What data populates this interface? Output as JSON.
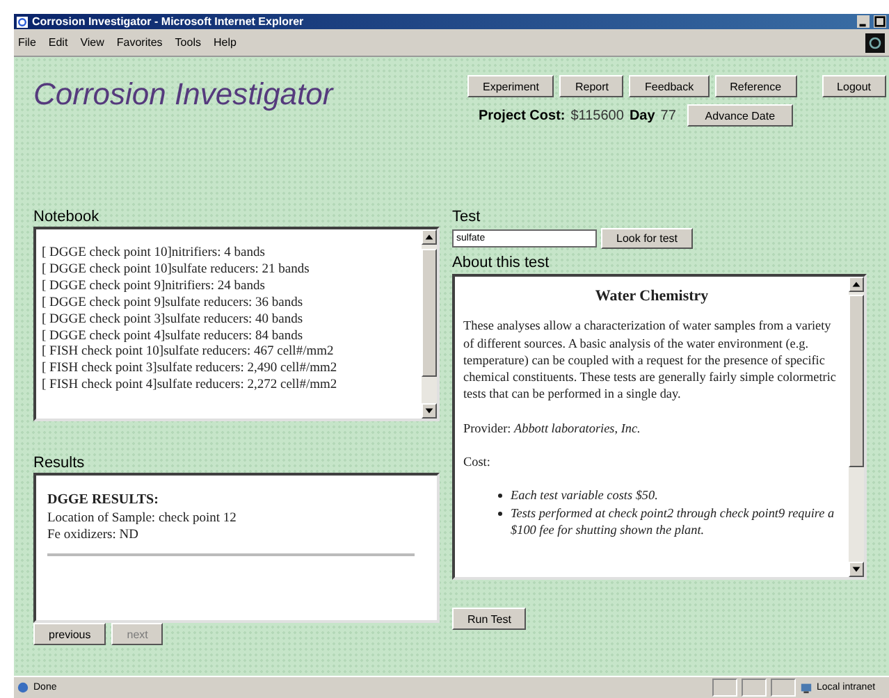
{
  "window": {
    "title": "Corrosion Investigator - Microsoft Internet Explorer"
  },
  "menu": [
    "File",
    "Edit",
    "View",
    "Favorites",
    "Tools",
    "Help"
  ],
  "header": {
    "title": "Corrosion Investigator",
    "nav_buttons": [
      "Experiment",
      "Report",
      "Feedback",
      "Reference"
    ],
    "logout": "Logout",
    "project_cost_label": "Project Cost:",
    "project_cost": "$115600",
    "day_label": "Day",
    "day": "77",
    "advance_button": "Advance Date"
  },
  "notebook": {
    "title": "Notebook",
    "entries": [
      "[ DGGE check point 10]nitrifiers: 4 bands",
      "[ DGGE check point 10]sulfate reducers: 21 bands",
      "[ DGGE check point 9]nitrifiers: 24 bands",
      "[ DGGE check point 9]sulfate reducers: 36 bands",
      "[ DGGE check point 3]sulfate reducers: 40 bands",
      "[ DGGE check point 4]sulfate reducers: 84 bands",
      "[ FISH check point 10]sulfate reducers: 467 cell#/mm2",
      "[ FISH check point 3]sulfate reducers: 2,490 cell#/mm2",
      "[ FISH check point 4]sulfate reducers: 2,272 cell#/mm2"
    ]
  },
  "results": {
    "title": "Results",
    "heading": "DGGE RESULTS:",
    "lines": [
      "Location of Sample: check point 12",
      "Fe oxidizers: ND"
    ]
  },
  "pager": [
    {
      "label": "previous",
      "disabled": false
    },
    {
      "label": "next",
      "disabled": true
    }
  ],
  "test": {
    "title": "Test",
    "value": "sulfate",
    "button": "Look for test"
  },
  "about": {
    "title": "About this test",
    "heading": "Water Chemistry",
    "paragraph": "These analyses allow a characterization of water samples from a variety of different sources. A basic analysis of the water environment (e.g. temperature) can be coupled with a request for the presence of specific chemical constituents. These tests are generally fairly simple colormetric tests that can be performed in a single day.",
    "provider": "Provider: *Abbott laboratories, Inc.*",
    "cost_label": "Cost:",
    "cost_items": [
      "Each test variable costs $50.",
      "Tests performed at check point2 through check point9 require a $100 fee for shutting shown the plant."
    ]
  },
  "run_button": "Run Test",
  "status_bar": {
    "text": "Done",
    "zone": "Local intranet"
  }
}
